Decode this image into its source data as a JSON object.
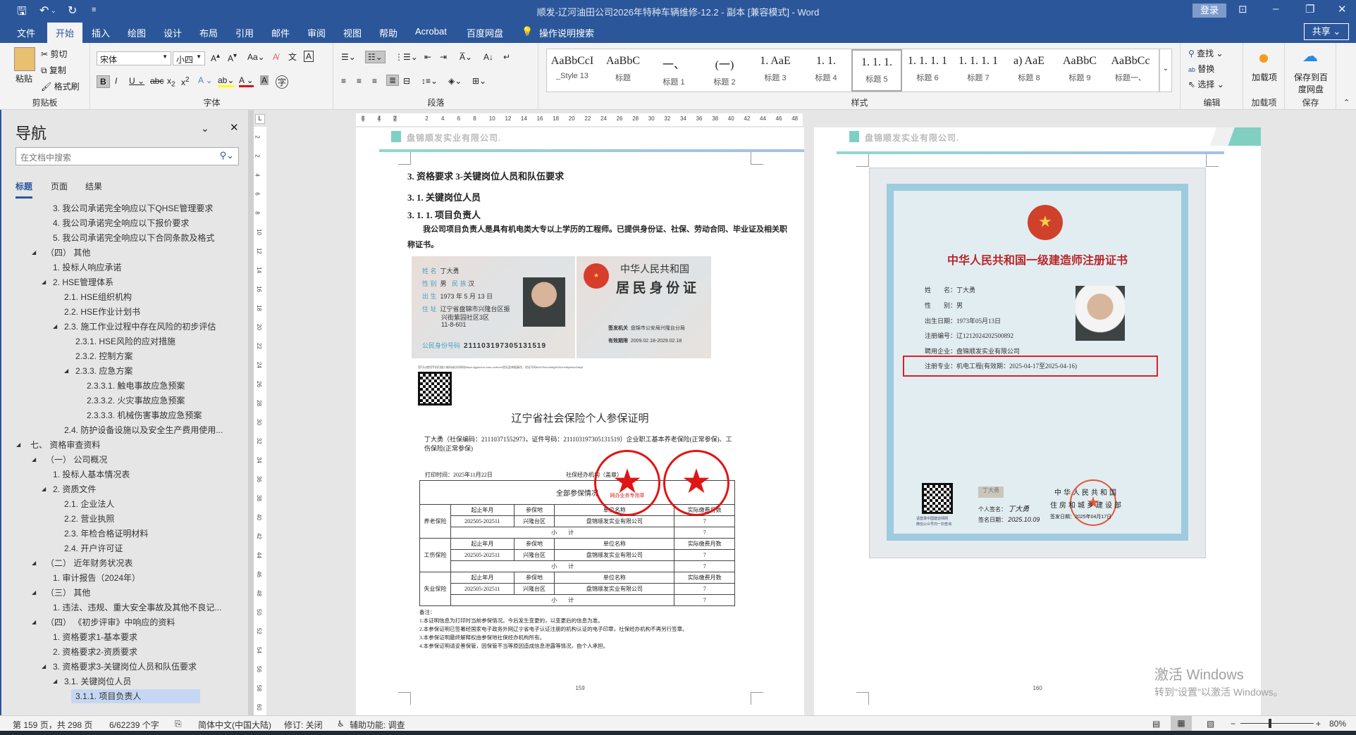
{
  "window": {
    "title": "顺发-辽河油田公司2026年特种车辆维修-12.2 - 副本 [兼容模式] - Word",
    "login": "登录",
    "share": "共享"
  },
  "tabs": [
    "文件",
    "开始",
    "插入",
    "绘图",
    "设计",
    "布局",
    "引用",
    "邮件",
    "审阅",
    "视图",
    "帮助",
    "Acrobat",
    "百度网盘"
  ],
  "tell_me": "操作说明搜索",
  "ribbon": {
    "clipboard": {
      "label": "剪贴板",
      "paste": "粘贴",
      "cut": "剪切",
      "copy": "复制",
      "format_painter": "格式刷"
    },
    "font": {
      "label": "字体",
      "font_name": "宋体",
      "font_size": "小四"
    },
    "paragraph": {
      "label": "段落"
    },
    "styles": {
      "label": "样式",
      "items": [
        {
          "preview": "AaBbCcI",
          "name": "_Style 13"
        },
        {
          "preview": "AaBbC",
          "name": "标题"
        },
        {
          "preview": "一、",
          "name": "标题 1"
        },
        {
          "preview": "(一)",
          "name": "标题 2"
        },
        {
          "preview": "1.  AaE",
          "name": "标题 3"
        },
        {
          "preview": "1. 1.",
          "name": "标题 4"
        },
        {
          "preview": "1. 1. 1.",
          "name": "标题 5"
        },
        {
          "preview": "1. 1. 1. 1",
          "name": "标题 6"
        },
        {
          "preview": "1. 1. 1. 1",
          "name": "标题 7"
        },
        {
          "preview": "a)  AaE",
          "name": "标题 8"
        },
        {
          "preview": "AaBbC",
          "name": "标题 9"
        },
        {
          "preview": "AaBbCc",
          "name": "标题一、"
        }
      ],
      "selected": "标题 5"
    },
    "editing": {
      "label": "编辑",
      "find": "查找",
      "replace": "替换",
      "select": "选择"
    },
    "addins": {
      "label": "加载项",
      "button": "加载项"
    },
    "save": {
      "label": "保存",
      "button": "保存到百度网盘"
    }
  },
  "nav": {
    "title": "导航",
    "search_placeholder": "在文档中搜索",
    "tabs": [
      "标题",
      "页面",
      "结果"
    ],
    "items": [
      {
        "level": 3,
        "text": "3. 我公司承诺完全响应以下QHSE管理要求"
      },
      {
        "level": 3,
        "text": "4. 我公司承诺完全响应以下报价要求"
      },
      {
        "level": 3,
        "text": "5. 我公司承诺完全响应以下合同条款及格式"
      },
      {
        "level": 2,
        "text": "（四） 其他",
        "expanded": true
      },
      {
        "level": 3,
        "text": "1. 投标人响应承诺"
      },
      {
        "level": 3,
        "text": "2. HSE管理体系",
        "expanded": true
      },
      {
        "level": 4,
        "text": "2.1. HSE组织机构"
      },
      {
        "level": 4,
        "text": "2.2. HSE作业计划书"
      },
      {
        "level": 4,
        "text": "2.3. 施工作业过程中存在风险的初步评估",
        "expanded": true
      },
      {
        "level": 5,
        "text": "2.3.1. HSE风险的应对措施"
      },
      {
        "level": 5,
        "text": "2.3.2. 控制方案"
      },
      {
        "level": 5,
        "text": "2.3.3. 应急方案",
        "expanded": true
      },
      {
        "level": 6,
        "text": "2.3.3.1. 触电事故应急预案"
      },
      {
        "level": 6,
        "text": "2.3.3.2. 火灾事故应急预案"
      },
      {
        "level": 6,
        "text": "2.3.3.3. 机械伤害事故应急预案"
      },
      {
        "level": 4,
        "text": "2.4. 防护设备设施以及安全生产费用使用..."
      },
      {
        "level": 1,
        "text": "七、 资格审查资料",
        "expanded": true
      },
      {
        "level": 2,
        "text": "（一） 公司概况",
        "expanded": true
      },
      {
        "level": 3,
        "text": "1. 投标人基本情况表"
      },
      {
        "level": 3,
        "text": "2. 资质文件",
        "expanded": true
      },
      {
        "level": 4,
        "text": "2.1. 企业法人"
      },
      {
        "level": 4,
        "text": "2.2. 营业执照"
      },
      {
        "level": 4,
        "text": "2.3. 年检合格证明材料"
      },
      {
        "level": 4,
        "text": "2.4. 开户许可证"
      },
      {
        "level": 2,
        "text": "（二） 近年财务状况表",
        "expanded": true
      },
      {
        "level": 3,
        "text": "1. 审计报告（2024年）"
      },
      {
        "level": 2,
        "text": "（三） 其他",
        "expanded": true
      },
      {
        "level": 3,
        "text": "1. 违法、违规、重大安全事故及其他不良记..."
      },
      {
        "level": 2,
        "text": "（四） 《初步评审》中响应的资料",
        "expanded": true
      },
      {
        "level": 3,
        "text": "1. 资格要求1-基本要求"
      },
      {
        "level": 3,
        "text": "2. 资格要求2-资质要求"
      },
      {
        "level": 3,
        "text": "3. 资格要求3-关键岗位人员和队伍要求",
        "expanded": true
      },
      {
        "level": 4,
        "text": "3.1. 关键岗位人员",
        "expanded": true
      },
      {
        "level": 5,
        "text": "3.1.1. 项目负责人",
        "selected": true
      }
    ]
  },
  "ruler": {
    "h_ticks": [
      "6",
      "4",
      "2",
      "",
      "2",
      "4",
      "6",
      "8",
      "10",
      "12",
      "14",
      "16",
      "18",
      "20",
      "22",
      "24",
      "26",
      "28",
      "30",
      "32",
      "34",
      "36",
      "38",
      "40",
      "42",
      "44",
      "46",
      "48"
    ],
    "v_ticks": [
      "2",
      "2",
      "4",
      "6",
      "8",
      "10",
      "12",
      "14",
      "16",
      "18",
      "20",
      "22",
      "24",
      "26",
      "28",
      "30",
      "32",
      "34",
      "36",
      "38",
      "40",
      "42",
      "44",
      "46",
      "48",
      "50",
      "52",
      "54",
      "56",
      "58",
      "60"
    ]
  },
  "page1": {
    "header": "盘锦顺发实业有限公司.",
    "h1": "3. 资格要求 3-关键岗位人员和队伍要求",
    "h2": "3. 1. 关键岗位人员",
    "h3": "3. 1. 1. 项目负责人",
    "body": "我公司项目负责人是具有机电类大专以上学历的工程师。已提供身份证、社保、劳动合同、毕业证及相关职称证书。",
    "id_front": {
      "name_k": "姓 名",
      "name": "丁大勇",
      "sex_k": "性 别",
      "sex": "男",
      "eth_k": "民 族",
      "eth": "汉",
      "birth_k": "出 生",
      "birth": "1973 年 5 月 13 日",
      "addr_k": "住 址",
      "addr1": "辽宁省盘锦市兴隆台区振",
      "addr2": "兴街紫园社区3区",
      "addr3": "11-8-601",
      "id_k": "公民身份号码",
      "id": "211103197305131519"
    },
    "id_back": {
      "t1": "中华人民共和国",
      "t2": "居 民 身 份 证",
      "issuer_k": "签发机关",
      "issuer": "盘锦市公安局兴隆台分局",
      "valid_k": "有效期限",
      "valid": "2009.02.18-2029.02.18"
    },
    "verify": "您可以使用手机扫描二维码或访问网站https://ggfw.lnrc.com.cn/form/验证此单据真伪，验证号码b5d79a2c4e6g810k2nto6p8sbz2wty6",
    "ins_title": "辽宁省社会保险个人参保证明",
    "ins_person": "丁大勇（社保编码：21110371552973，证件号码：211103197305131519）企业职工基本养老保险(正常参保)、工伤保险(正常参保)",
    "print_time": "打印时间：2025年11月22日",
    "agency": "社保经办机构（盖章）",
    "table_title": "全部参保情况",
    "headers": [
      "起止年月",
      "参保地",
      "单位名称",
      "实际缴费月数"
    ],
    "subtotal": "小　　计",
    "rows": [
      {
        "type": "养老保险",
        "period": "202505-202511",
        "place": "兴隆台区",
        "unit": "盘锦顺发实业有限公司",
        "months": "7",
        "subtotal": "7"
      },
      {
        "type": "工伤保险",
        "period": "202505-202511",
        "place": "兴隆台区",
        "unit": "盘锦顺发实业有限公司",
        "months": "7",
        "subtotal": "7"
      },
      {
        "type": "失业保险",
        "period": "202505-202511",
        "place": "兴隆台区",
        "unit": "盘锦顺发实业有限公司",
        "months": "7",
        "subtotal": "7"
      }
    ],
    "stamp_text": "网办业务专用章",
    "notes": [
      "备注：",
      "1.本证明信息为打印时当前参保情况。今后发生变更的，以变更后的信息为准。",
      "2.本参保证明已签署经国家电子政务外网辽宁省电子认证注册的机构认证的电子印章，社保经办机构不再另行签章。",
      "3.本参保证明最终解释权由参保地社保经办机构所有。",
      "4.本参保证明请妥善保管，因保管不当等原因造成信息泄露等情况，由个人承担。"
    ],
    "page_no": "159"
  },
  "page2": {
    "header": "盘锦顺发实业有限公司.",
    "cert": {
      "title": "中华人民共和国一级建造师注册证书",
      "name": "姓　　名：丁大勇",
      "sex": "性　　别：男",
      "birth": "出生日期：1973年05月13日",
      "reg_no": "注册编号：辽1212024202500892",
      "employer": "聘用企业：盘锦顺发实业有限公司",
      "major": "注册专业：机电工程(有效期：2025-04-17至2025-04-16)",
      "qr_caption1": "请登录中国建造师网",
      "qr_caption2": "微信公众号扫一扫查询",
      "sign_k": "个人签名：",
      "sign": "丁大勇",
      "sign_date_k": "签名日期：",
      "sign_date": "2025.10.09",
      "issuer1": "中华人民共和国",
      "issuer2": "住房和城乡建设部",
      "issue_date": "签发日期：2025年04月17日"
    },
    "highlight_color": "#d9202a",
    "page_no": "160"
  },
  "status": {
    "page": "第 159 页，共 298 页",
    "words": "6/62239 个字",
    "language": "简体中文(中国大陆)",
    "track": "修订: 关闭",
    "accessibility": "辅助功能: 调查",
    "zoom": "80%",
    "zoom_level": 0.8
  },
  "watermark": {
    "line1": "激活 Windows",
    "line2": "转到\"设置\"以激活 Windows。"
  },
  "colors": {
    "brand": "#2b579a",
    "stamp": "#e01515"
  }
}
